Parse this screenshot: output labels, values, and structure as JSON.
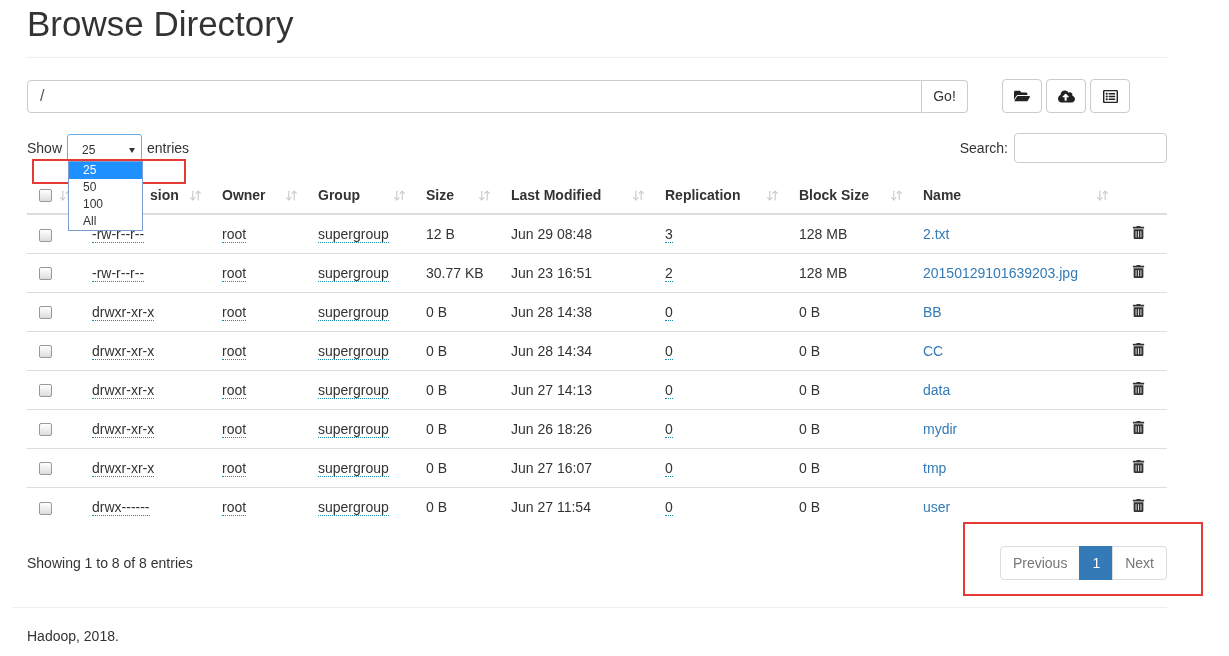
{
  "title": "Browse Directory",
  "path_field": {
    "value": "/"
  },
  "go_button": "Go!",
  "toolbar_buttons": [
    {
      "kind": "folder"
    },
    {
      "kind": "upload"
    },
    {
      "kind": "list"
    }
  ],
  "page_length": {
    "label_before": "Show",
    "value": "25",
    "label_after": "entries",
    "expanded": true,
    "options": [
      {
        "label": "25",
        "selected": true
      },
      {
        "label": "50",
        "selected": false
      },
      {
        "label": "100",
        "selected": false
      },
      {
        "label": "All",
        "selected": false
      }
    ]
  },
  "search": {
    "label": "Search:"
  },
  "table": {
    "select_all": {
      "checked": false
    },
    "columns": [
      {
        "kind": "abbr",
        "label": "sion"
      },
      {
        "kind": "abbr",
        "label": "Owner"
      },
      {
        "kind": "abbr",
        "label": "Group"
      },
      {
        "kind": "text",
        "label": "Size"
      },
      {
        "kind": "text",
        "label": "Last Modified"
      },
      {
        "kind": "abbr",
        "label": "Replication"
      },
      {
        "kind": "text",
        "label": "Block Size"
      },
      {
        "kind": "link",
        "label": "Name"
      }
    ],
    "rows": [
      {
        "checked": false,
        "cells": [
          "-rw-r--r--",
          "root",
          "supergroup",
          "12 B",
          "Jun 29 08:48",
          "3",
          "128 MB",
          "2.txt"
        ]
      },
      {
        "checked": false,
        "cells": [
          "-rw-r--r--",
          "root",
          "supergroup",
          "30.77 KB",
          "Jun 23 16:51",
          "2",
          "128 MB",
          "20150129101639203.jpg"
        ]
      },
      {
        "checked": false,
        "cells": [
          "drwxr-xr-x",
          "root",
          "supergroup",
          "0 B",
          "Jun 28 14:38",
          "0",
          "0 B",
          "BB"
        ]
      },
      {
        "checked": false,
        "cells": [
          "drwxr-xr-x",
          "root",
          "supergroup",
          "0 B",
          "Jun 28 14:34",
          "0",
          "0 B",
          "CC"
        ]
      },
      {
        "checked": false,
        "cells": [
          "drwxr-xr-x",
          "root",
          "supergroup",
          "0 B",
          "Jun 27 14:13",
          "0",
          "0 B",
          "data"
        ]
      },
      {
        "checked": false,
        "cells": [
          "drwxr-xr-x",
          "root",
          "supergroup",
          "0 B",
          "Jun 26 18:26",
          "0",
          "0 B",
          "mydir"
        ]
      },
      {
        "checked": false,
        "cells": [
          "drwxr-xr-x",
          "root",
          "supergroup",
          "0 B",
          "Jun 27 16:07",
          "0",
          "0 B",
          "tmp"
        ]
      },
      {
        "checked": false,
        "cells": [
          "drwx------",
          "root",
          "supergroup",
          "0 B",
          "Jun 27 11:54",
          "0",
          "0 B",
          "user"
        ]
      }
    ]
  },
  "info": "Showing 1 to 8 of 8 entries",
  "pagination": [
    {
      "label": "Previous",
      "disabled": true,
      "selected": false
    },
    {
      "label": "1",
      "disabled": false,
      "selected": true
    },
    {
      "label": "Next",
      "disabled": true,
      "selected": false
    }
  ],
  "footer": "Hadoop, 2018."
}
